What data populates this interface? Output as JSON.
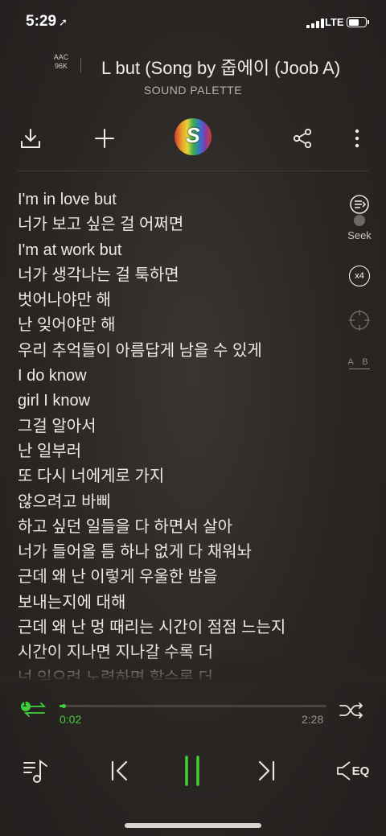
{
  "status_bar": {
    "time": "5:29",
    "location_icon": "location-arrow-icon",
    "network": "LTE"
  },
  "header": {
    "quality_line1": "AAC",
    "quality_line2": "96K",
    "song_title": "L but (Song by 줍에이 (Joob A)",
    "artist": "SOUND PALETTE",
    "album_letter": "S"
  },
  "toolbar": {
    "download_icon": "download-icon",
    "add_icon": "plus-icon",
    "share_icon": "share-icon",
    "more_icon": "more-vertical-icon"
  },
  "side_controls": {
    "seek_label": "Seek",
    "speed_label": "x4",
    "ab_label": "A B"
  },
  "lyrics": [
    "I'm in love but",
    "너가 보고 싶은 걸 어쩌면",
    "I'm at work but",
    "너가 생각나는 걸 툭하면",
    "벗어나야만 해",
    "난 잊어야만 해",
    "우리 추억들이 아름답게 남을 수 있게",
    "I do know",
    "girl I know",
    "그걸 알아서",
    "난 일부러",
    "또 다시 너에게로 가지",
    "않으려고 바삐",
    "하고 싶던 일들을 다 하면서 살아",
    "너가 들어올 틈 하나 없게 다 채워놔",
    "근데 왜 난 이렇게 우울한 밤을",
    "보내는지에 대해",
    "근데 왜 난 멍 때리는 시간이 점점 느는지",
    "시간이 지나면 지나갈 수록 더",
    "넌 잊으려 노력하면 할수록 더"
  ],
  "player": {
    "elapsed": "0:02",
    "total": "2:28",
    "progress_fraction": 0.0135,
    "repeat_badge": "1",
    "eq_label": "EQ",
    "accent_color": "#3fd13a"
  }
}
